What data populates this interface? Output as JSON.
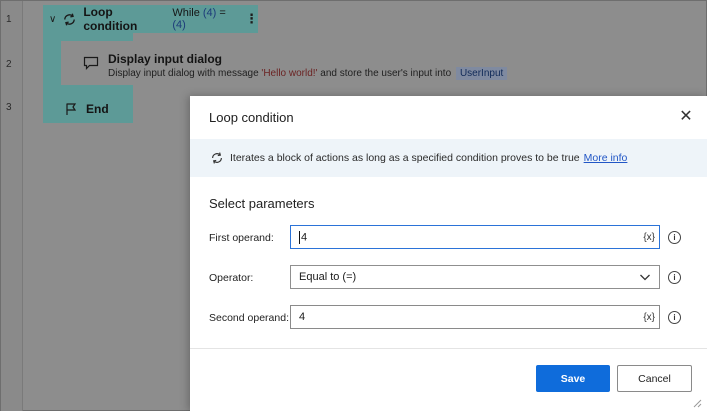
{
  "editor": {
    "line_numbers": [
      "1",
      "2",
      "3"
    ],
    "loop": {
      "title": "Loop condition",
      "summary_prefix": "While",
      "summary_left": "(4)",
      "summary_op": "=",
      "summary_right": "(4)"
    },
    "action": {
      "title": "Display input dialog",
      "desc_prefix": "Display input dialog with message",
      "desc_message": "'Hello world!'",
      "desc_middle": "and store the user's input into",
      "desc_variable": "UserInput"
    },
    "end_label": "End"
  },
  "dialog": {
    "title": "Loop condition",
    "close_glyph": "✕",
    "info_text": "Iterates a block of actions as long as a specified condition proves to be true",
    "more_info_label": "More info",
    "section_title": "Select parameters",
    "params": [
      {
        "label": "First operand:",
        "value": "4",
        "var_button": "{x}"
      },
      {
        "label": "Operator:",
        "value": "Equal to (=)"
      },
      {
        "label": "Second operand:",
        "value": "4",
        "var_button": "{x}"
      }
    ],
    "help_glyph": "i",
    "save_label": "Save",
    "cancel_label": "Cancel"
  },
  "colors": {
    "accent": "#0f6cdb",
    "loop_block": "#5d9a97",
    "info_bar": "#eef4f9",
    "link": "#2156c6"
  },
  "icons": {
    "loop": "loop-arrows-icon",
    "action": "message-dialog-icon",
    "end": "flag-icon",
    "close": "close-icon",
    "info": "loop-arrows-icon",
    "dropdown": "chevron-down-icon",
    "help": "info-circle-icon"
  }
}
